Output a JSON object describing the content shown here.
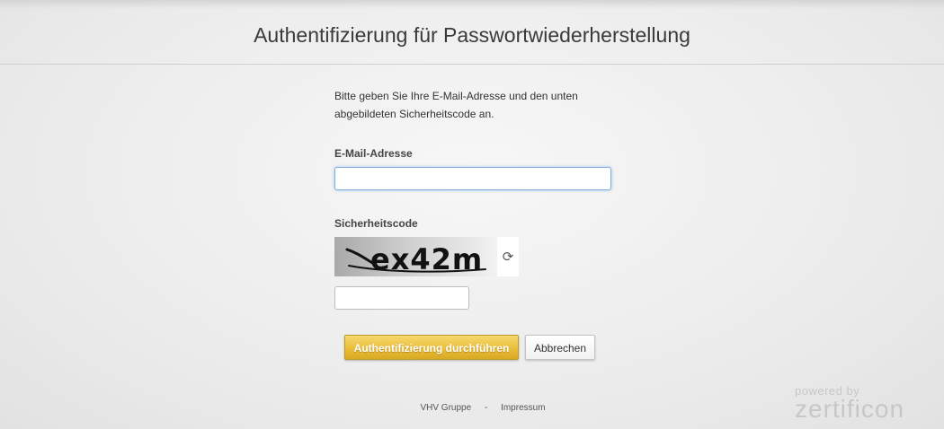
{
  "header": {
    "title": "Authentifizierung für Passwortwiederherstellung"
  },
  "form": {
    "intro_line1": "Bitte geben Sie Ihre E-Mail-Adresse und den unten",
    "intro_line2": "abgebildeten Sicherheitscode an.",
    "email_label": "E-Mail-Adresse",
    "email_value": "",
    "captcha_label": "Sicherheitscode",
    "captcha_text": "ex42m",
    "captcha_refresh_icon": "refresh-icon",
    "captcha_value": "",
    "submit_label": "Authentifizierung durchführen",
    "cancel_label": "Abbrechen"
  },
  "footer": {
    "link1": "VHV Gruppe",
    "separator": "-",
    "link2": "Impressum"
  },
  "branding": {
    "powered_by": "powered by",
    "brand": "zertificon"
  },
  "colors": {
    "primary_button": "#eabf3b",
    "input_focus": "#7fb0dd"
  }
}
